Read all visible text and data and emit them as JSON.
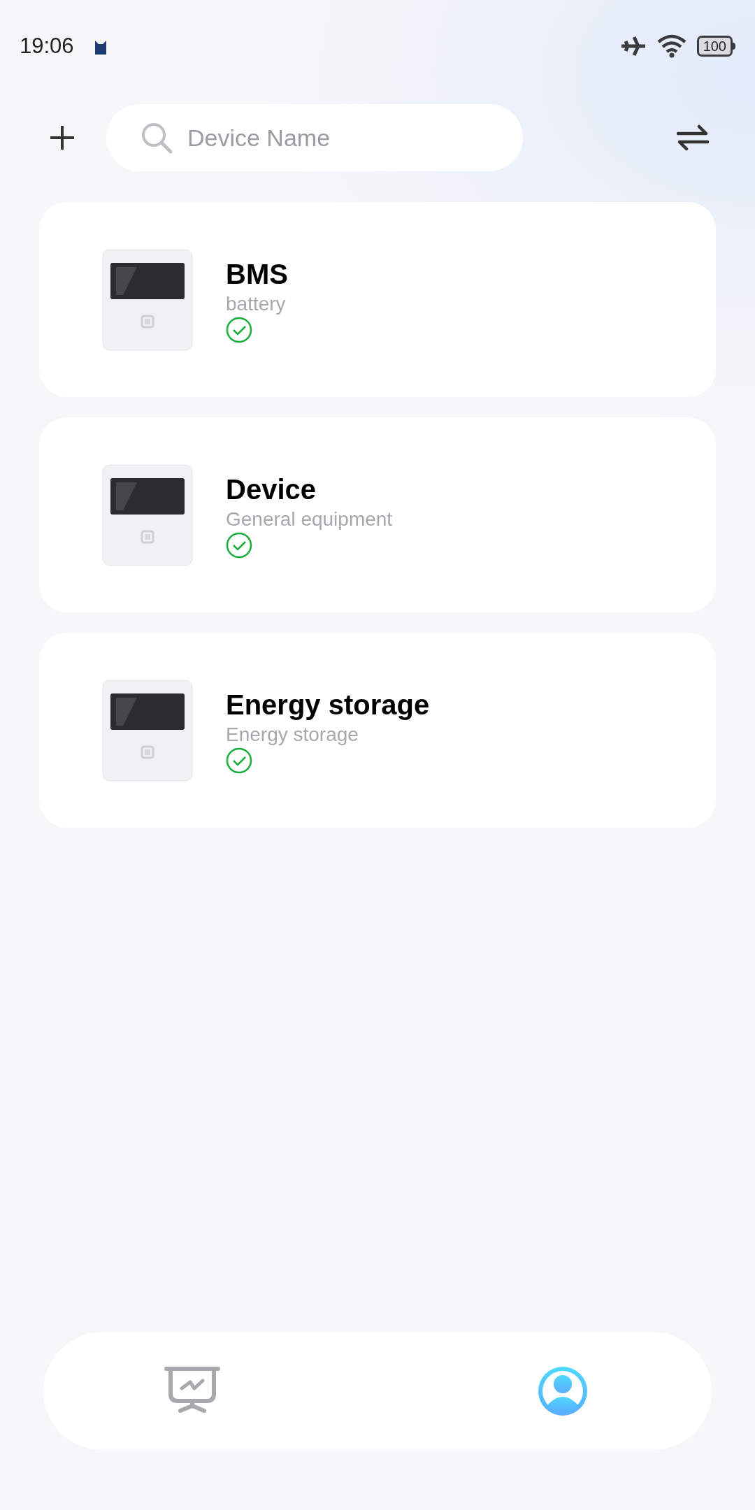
{
  "status_bar": {
    "time": "19:06",
    "battery": "100"
  },
  "search": {
    "placeholder": "Device Name"
  },
  "devices": [
    {
      "name": "BMS",
      "type": "battery",
      "online": true
    },
    {
      "name": "Device",
      "type": "General equipment",
      "online": true
    },
    {
      "name": "Energy storage",
      "type": "Energy storage",
      "online": true
    }
  ],
  "tabs": [
    {
      "kind": "dashboard",
      "selected": false
    },
    {
      "kind": "profile",
      "selected": true
    }
  ]
}
